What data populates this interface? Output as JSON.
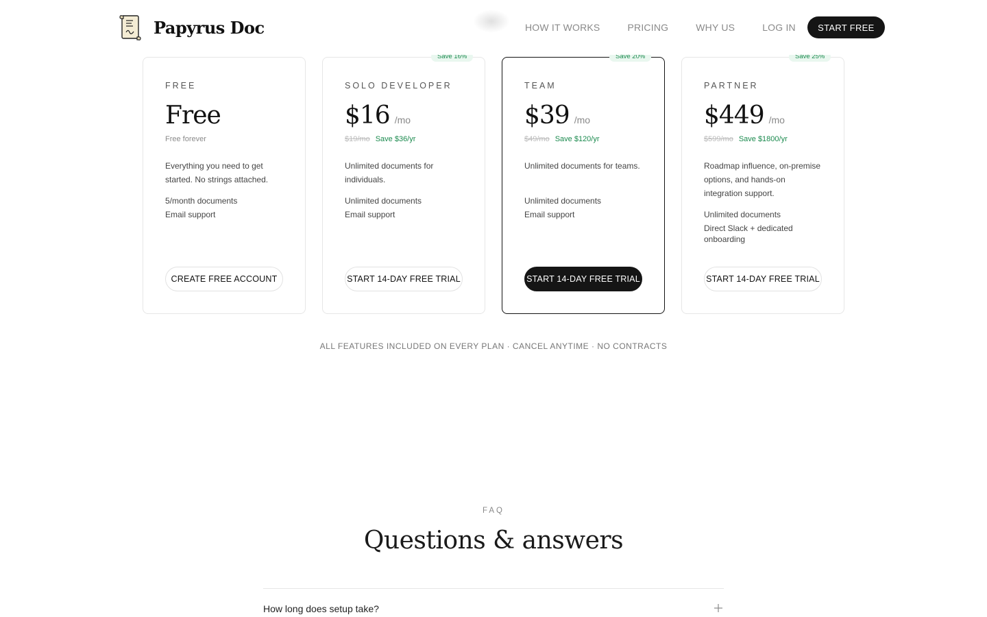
{
  "header": {
    "brand": "Papyrus Doc",
    "nav": [
      {
        "label": "HOW IT WORKS"
      },
      {
        "label": "PRICING"
      },
      {
        "label": "WHY US"
      },
      {
        "label": "LOG IN"
      }
    ],
    "cta_label": "START FREE"
  },
  "plans": [
    {
      "tier": "FREE",
      "price": "Free",
      "per": "",
      "old_price": "",
      "save_text": "",
      "note": "Free forever",
      "badge": "",
      "description": "Everything you need to get started. No strings attached.",
      "features": [
        "5/month documents",
        "Email support"
      ],
      "cta": "CREATE FREE ACCOUNT"
    },
    {
      "tier": "SOLO DEVELOPER",
      "price": "$16",
      "per": "/mo",
      "old_price": "$19/mo",
      "save_text": "Save $36/yr",
      "badge": "Save 16%",
      "description": "Unlimited documents for individuals.",
      "features": [
        "Unlimited documents",
        "Email support"
      ],
      "cta": "START 14-DAY FREE TRIAL"
    },
    {
      "tier": "TEAM",
      "price": "$39",
      "per": "/mo",
      "old_price": "$49/mo",
      "save_text": "Save $120/yr",
      "badge": "Save 20%",
      "description": "Unlimited documents for teams.",
      "features": [
        "Unlimited documents",
        "Email support"
      ],
      "cta": "START 14-DAY FREE TRIAL"
    },
    {
      "tier": "PARTNER",
      "price": "$449",
      "per": "/mo",
      "old_price": "$599/mo",
      "save_text": "Save $1800/yr",
      "badge": "Save 25%",
      "description": "Roadmap influence, on-premise options, and hands-on integration support.",
      "features": [
        "Unlimited documents",
        "Direct Slack + dedicated onboarding"
      ],
      "cta": "START 14-DAY FREE TRIAL"
    }
  ],
  "footnote": "ALL FEATURES INCLUDED ON EVERY PLAN · CANCEL ANYTIME · NO CONTRACTS",
  "faq": {
    "eyebrow": "FAQ",
    "title": "Questions & answers",
    "questions": [
      "How long does setup take?"
    ]
  },
  "colors": {
    "accent_green": "#1b8a4e",
    "dark": "#151515"
  }
}
